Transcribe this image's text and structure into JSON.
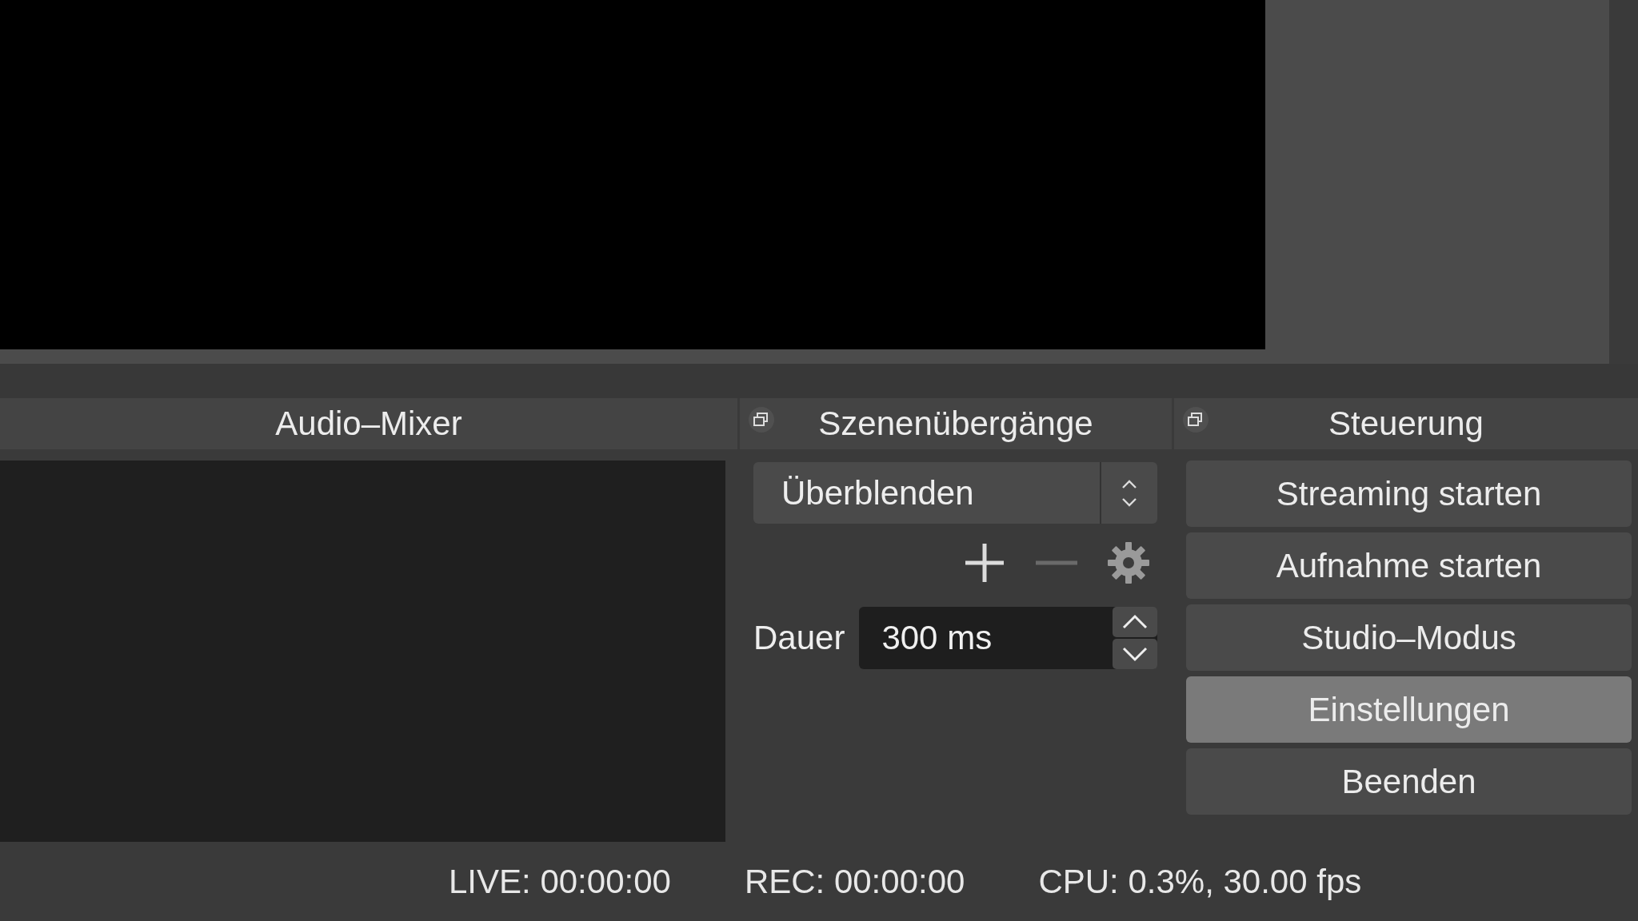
{
  "audio_mixer": {
    "title": "Audio–Mixer"
  },
  "transitions": {
    "title": "Szenenübergänge",
    "select_value": "Überblenden",
    "tools": [
      {
        "kind": "add",
        "disabled": false
      },
      {
        "kind": "remove",
        "disabled": true
      },
      {
        "kind": "settings",
        "disabled": false
      }
    ],
    "duration_label": "Dauer",
    "duration_value": "300 ms"
  },
  "controls": {
    "title": "Steuerung",
    "buttons": [
      {
        "label": "Streaming starten",
        "selected": false
      },
      {
        "label": "Aufnahme starten",
        "selected": false
      },
      {
        "label": "Studio–Modus",
        "selected": false
      },
      {
        "label": "Einstellungen",
        "selected": true
      },
      {
        "label": "Beenden",
        "selected": false
      }
    ]
  },
  "status_bar": [
    "LIVE: 00:00:00",
    "REC: 00:00:00",
    "CPU: 0.3%, 30.00 fps"
  ]
}
